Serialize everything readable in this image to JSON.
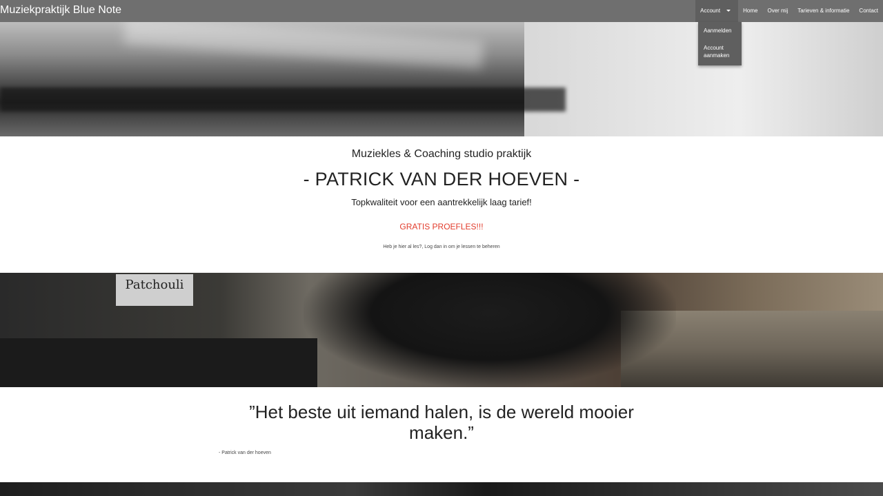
{
  "header": {
    "brand": "Muziekpraktijk Blue Note",
    "nav": {
      "account": "Account",
      "home": "Home",
      "about": "Over mij",
      "pricing": "Tarieven & informatie",
      "contact": "Contact"
    },
    "account_dropdown": {
      "login": "Aanmelden",
      "create_account": "Account aanmaken"
    }
  },
  "hero": {
    "subtitle": "Muziekles & Coaching studio praktijk",
    "title": "- PATRICK VAN DER HOEVEN -",
    "tagline": "Topkwaliteit voor een aantrekkelijk laag tarief!",
    "promo": "GRATIS PROEFLES!!!",
    "note": "Heb je hier al les?, Log dan in om je lessen te beheren"
  },
  "banner_2": {
    "sign_text": "Patchouli"
  },
  "quote": {
    "text": "”Het beste uit iemand halen, is de wereld mooier maken.”",
    "author": "- Patrick van der hoeven"
  },
  "colors": {
    "navbar": "#6f6f6f",
    "dropdown": "#5f5f5f",
    "promo": "#e23b2b",
    "text": "#222222"
  }
}
